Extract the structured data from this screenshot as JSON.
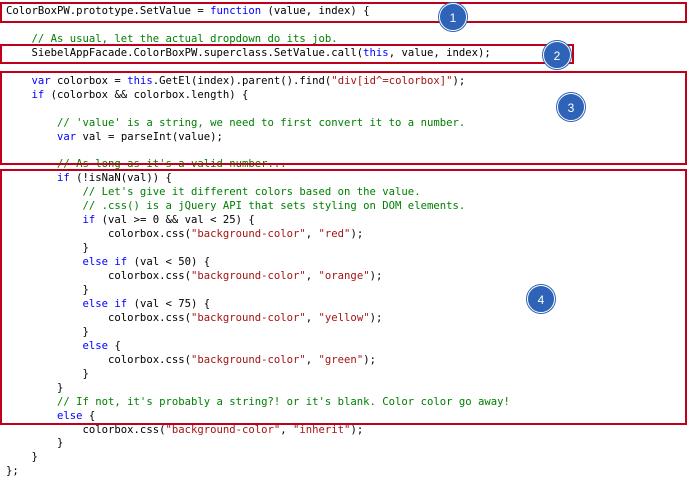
{
  "colors": {
    "keyword": "#0000ff",
    "string": "#a31515",
    "comment": "#008000",
    "plain": "#000000",
    "box_border": "#c0001a",
    "badge_fill": "#2e63b8"
  },
  "code": {
    "lines": [
      [
        {
          "t": "plain",
          "v": "ColorBoxPW.prototype.SetValue = "
        },
        {
          "t": "keyword",
          "v": "function"
        },
        {
          "t": "plain",
          "v": " (value, index) {"
        }
      ],
      [],
      [
        {
          "t": "comment",
          "v": "    // As usual, let the actual dropdown do its job."
        }
      ],
      [
        {
          "t": "plain",
          "v": "    SiebelAppFacade.ColorBoxPW.superclass.SetValue.call("
        },
        {
          "t": "keyword",
          "v": "this"
        },
        {
          "t": "plain",
          "v": ", value, index);"
        }
      ],
      [],
      [
        {
          "t": "keyword",
          "v": "    var"
        },
        {
          "t": "plain",
          "v": " colorbox = "
        },
        {
          "t": "keyword",
          "v": "this"
        },
        {
          "t": "plain",
          "v": ".GetEl(index).parent().find("
        },
        {
          "t": "string",
          "v": "\"div[id^=colorbox]\""
        },
        {
          "t": "plain",
          "v": ");"
        }
      ],
      [
        {
          "t": "keyword",
          "v": "    if"
        },
        {
          "t": "plain",
          "v": " (colorbox && colorbox.length) {"
        }
      ],
      [],
      [
        {
          "t": "comment",
          "v": "        // 'value' is a string, we need to first convert it to a number."
        }
      ],
      [
        {
          "t": "keyword",
          "v": "        var"
        },
        {
          "t": "plain",
          "v": " val = parseInt(value);"
        }
      ],
      [],
      [
        {
          "t": "comment",
          "v": "        // As long as it's a valid number..."
        }
      ],
      [
        {
          "t": "keyword",
          "v": "        if"
        },
        {
          "t": "plain",
          "v": " (!isNaN(val)) {"
        }
      ],
      [
        {
          "t": "comment",
          "v": "            // Let's give it different colors based on the value."
        }
      ],
      [
        {
          "t": "comment",
          "v": "            // .css() is a jQuery API that sets styling on DOM elements."
        }
      ],
      [
        {
          "t": "keyword",
          "v": "            if"
        },
        {
          "t": "plain",
          "v": " (val >= 0 && val < 25) {"
        }
      ],
      [
        {
          "t": "plain",
          "v": "                colorbox.css("
        },
        {
          "t": "string",
          "v": "\"background-color\""
        },
        {
          "t": "plain",
          "v": ", "
        },
        {
          "t": "string",
          "v": "\"red\""
        },
        {
          "t": "plain",
          "v": ");"
        }
      ],
      [
        {
          "t": "plain",
          "v": "            }"
        }
      ],
      [
        {
          "t": "keyword",
          "v": "            else if"
        },
        {
          "t": "plain",
          "v": " (val < 50) {"
        }
      ],
      [
        {
          "t": "plain",
          "v": "                colorbox.css("
        },
        {
          "t": "string",
          "v": "\"background-color\""
        },
        {
          "t": "plain",
          "v": ", "
        },
        {
          "t": "string",
          "v": "\"orange\""
        },
        {
          "t": "plain",
          "v": ");"
        }
      ],
      [
        {
          "t": "plain",
          "v": "            }"
        }
      ],
      [
        {
          "t": "keyword",
          "v": "            else if"
        },
        {
          "t": "plain",
          "v": " (val < 75) {"
        }
      ],
      [
        {
          "t": "plain",
          "v": "                colorbox.css("
        },
        {
          "t": "string",
          "v": "\"background-color\""
        },
        {
          "t": "plain",
          "v": ", "
        },
        {
          "t": "string",
          "v": "\"yellow\""
        },
        {
          "t": "plain",
          "v": ");"
        }
      ],
      [
        {
          "t": "plain",
          "v": "            }"
        }
      ],
      [
        {
          "t": "keyword",
          "v": "            else"
        },
        {
          "t": "plain",
          "v": " {"
        }
      ],
      [
        {
          "t": "plain",
          "v": "                colorbox.css("
        },
        {
          "t": "string",
          "v": "\"background-color\""
        },
        {
          "t": "plain",
          "v": ", "
        },
        {
          "t": "string",
          "v": "\"green\""
        },
        {
          "t": "plain",
          "v": ");"
        }
      ],
      [
        {
          "t": "plain",
          "v": "            }"
        }
      ],
      [
        {
          "t": "plain",
          "v": "        }"
        }
      ],
      [
        {
          "t": "comment",
          "v": "        // If not, it's probably a string?! or it's blank. Color color go away!"
        }
      ],
      [
        {
          "t": "keyword",
          "v": "        else"
        },
        {
          "t": "plain",
          "v": " {"
        }
      ],
      [
        {
          "t": "plain",
          "v": "            colorbox.css("
        },
        {
          "t": "string",
          "v": "\"background-color\""
        },
        {
          "t": "plain",
          "v": ", "
        },
        {
          "t": "string",
          "v": "\"inherit\""
        },
        {
          "t": "plain",
          "v": ");"
        }
      ],
      [
        {
          "t": "plain",
          "v": "        }"
        }
      ],
      [
        {
          "t": "plain",
          "v": "    }"
        }
      ],
      [
        {
          "t": "plain",
          "v": "};"
        }
      ]
    ]
  },
  "annotations": [
    {
      "label": "1"
    },
    {
      "label": "2"
    },
    {
      "label": "3"
    },
    {
      "label": "4"
    }
  ]
}
